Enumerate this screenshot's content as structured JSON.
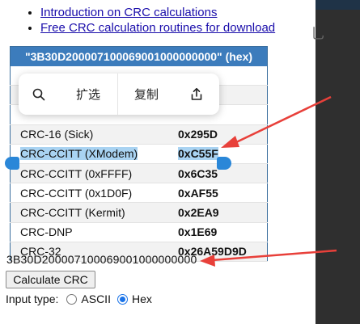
{
  "links": [
    "Introduction on CRC calculations",
    "Free CRC calculation routines for download"
  ],
  "right_glyph": "乚",
  "table": {
    "header": "\"3B30D200007100069001000000000\" (hex)",
    "rows": [
      {
        "name": "CRC-16 (Sick)",
        "value": "0x295D"
      },
      {
        "name": "CRC-CCITT (XModem)",
        "value": "0xC55F"
      },
      {
        "name": "CRC-CCITT (0xFFFF)",
        "value": "0x6C35"
      },
      {
        "name": "CRC-CCITT (0x1D0F)",
        "value": "0xAF55"
      },
      {
        "name": "CRC-CCITT (Kermit)",
        "value": "0x2EA9"
      },
      {
        "name": "CRC-DNP",
        "value": "0x1E69"
      },
      {
        "name": "CRC-32",
        "value": "0x26A59D9D"
      }
    ]
  },
  "popup": {
    "search_icon": "search-icon",
    "expand_label": "扩选",
    "copy_label": "复制",
    "share_icon": "share-icon"
  },
  "input_value": "3B30D200007100069001000000000",
  "calculate_label": "Calculate CRC",
  "input_type": {
    "label": "Input type:",
    "options": [
      "ASCII",
      "Hex"
    ],
    "selected": "Hex"
  },
  "colors": {
    "header_bg": "#3c7cbc",
    "selection": "#a9d3f2",
    "handle": "#2a87d8",
    "arrow": "#e8403a",
    "link": "#1a0dab"
  }
}
